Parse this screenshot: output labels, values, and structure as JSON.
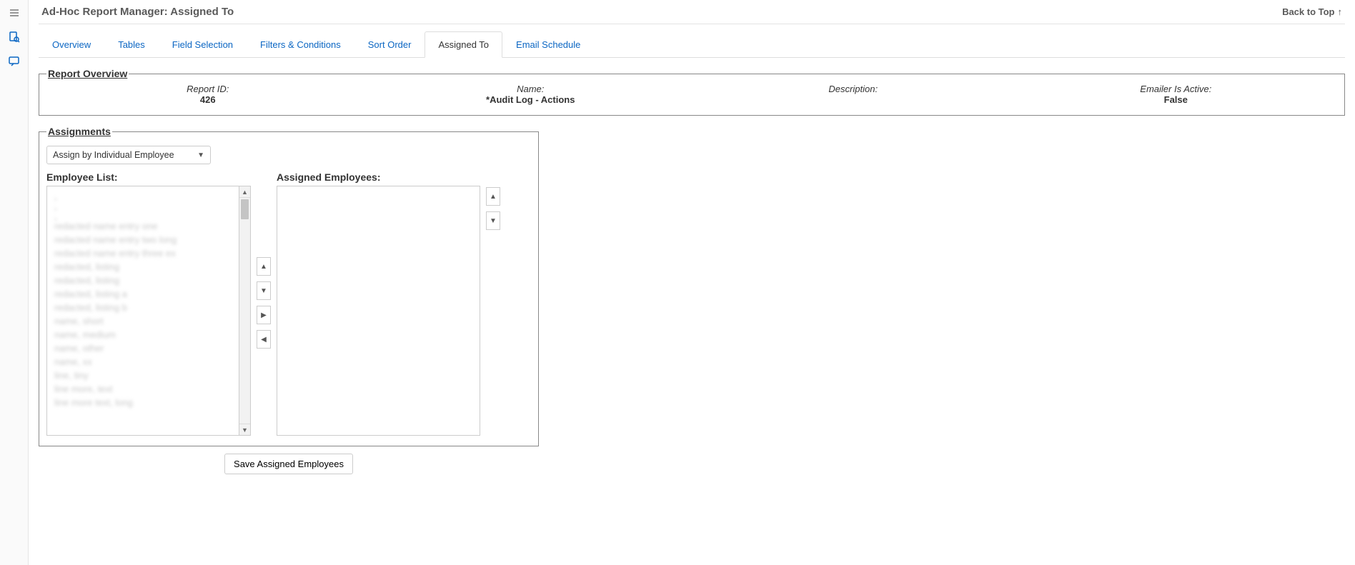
{
  "header": {
    "title": "Ad-Hoc Report Manager: Assigned To",
    "back_to_top": "Back to Top"
  },
  "tabs": [
    {
      "label": "Overview",
      "active": false
    },
    {
      "label": "Tables",
      "active": false
    },
    {
      "label": "Field Selection",
      "active": false
    },
    {
      "label": "Filters & Conditions",
      "active": false
    },
    {
      "label": "Sort Order",
      "active": false
    },
    {
      "label": "Assigned To",
      "active": true
    },
    {
      "label": "Email Schedule",
      "active": false
    }
  ],
  "overview": {
    "legend": "Report Overview",
    "report_id_label": "Report ID:",
    "report_id_value": "426",
    "name_label": "Name:",
    "name_value": "*Audit Log - Actions",
    "description_label": "Description:",
    "description_value": "",
    "emailer_label": "Emailer Is Active:",
    "emailer_value": "False"
  },
  "assignments": {
    "legend": "Assignments",
    "mode_selected": "Assign by Individual Employee",
    "employee_list_label": "Employee List:",
    "assigned_label": "Assigned Employees:",
    "employee_list": [
      ",",
      ",",
      ",",
      "redacted name entry one",
      "redacted name entry two long",
      "redacted name entry three ex",
      "redacted, listing",
      "redacted, listing",
      "redacted, listing a",
      "redacted, listing b",
      "name, short",
      "name, medium",
      "name, other",
      "name, xx",
      "line, tiny",
      "line more, text",
      "line more text, long"
    ],
    "assigned_list": []
  },
  "buttons": {
    "save": "Save Assigned Employees"
  }
}
